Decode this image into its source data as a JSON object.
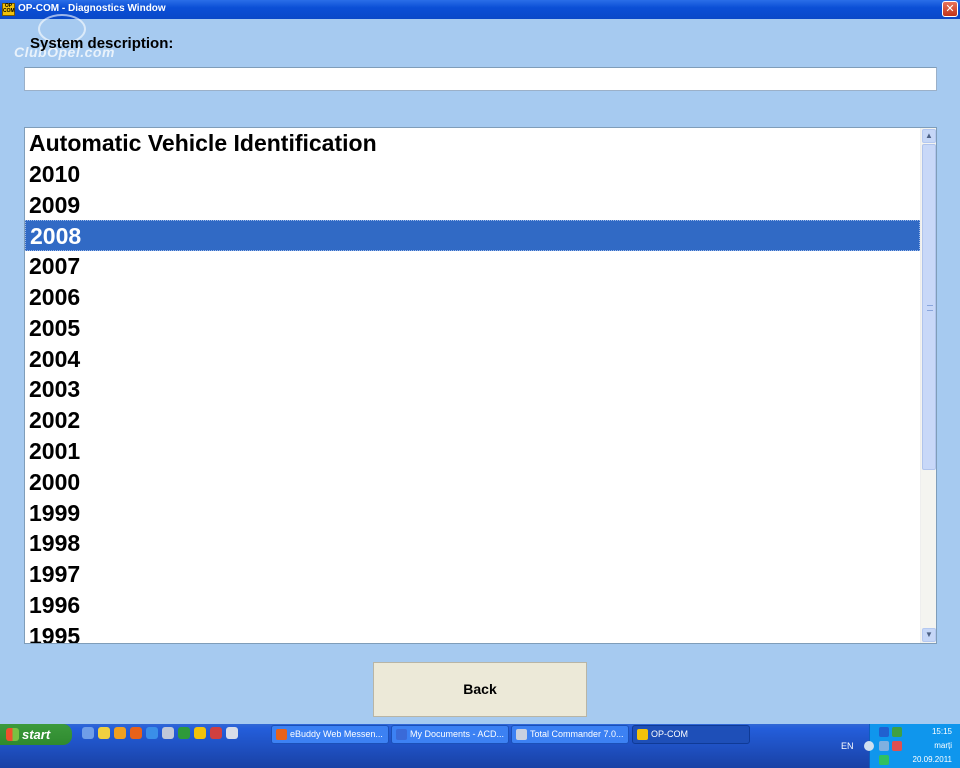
{
  "window": {
    "title": "OP-COM - Diagnostics Window",
    "app_icon_text": "OP COM",
    "close_glyph": "✕"
  },
  "watermark": "ClubOpel.com",
  "system_description": {
    "label": "System description:",
    "value": ""
  },
  "list": {
    "items": [
      "Automatic Vehicle Identification",
      "2010",
      "2009",
      "2008",
      "2007",
      "2006",
      "2005",
      "2004",
      "2003",
      "2002",
      "2001",
      "2000",
      "1999",
      "1998",
      "1997",
      "1996",
      "1995"
    ],
    "selected": "2008"
  },
  "scrollbar": {
    "up": "▲",
    "down": "▼"
  },
  "back_button": "Back",
  "taskbar": {
    "start_label": "start",
    "tasks": [
      {
        "label": "eBuddy Web Messen...",
        "icon": "firefox-icon",
        "color": "#e8621a"
      },
      {
        "label": "My Documents - ACD...",
        "icon": "acdsee-icon",
        "color": "#3a6ad8"
      },
      {
        "label": "Total Commander 7.0...",
        "icon": "total-commander-icon",
        "color": "#c8d0e0"
      },
      {
        "label": "OP-COM",
        "icon": "opcom-icon",
        "color": "#f2c20a"
      }
    ],
    "language": "EN",
    "clock_time": "15:15",
    "clock_day": "marți",
    "clock_date": "20.09.2011"
  }
}
